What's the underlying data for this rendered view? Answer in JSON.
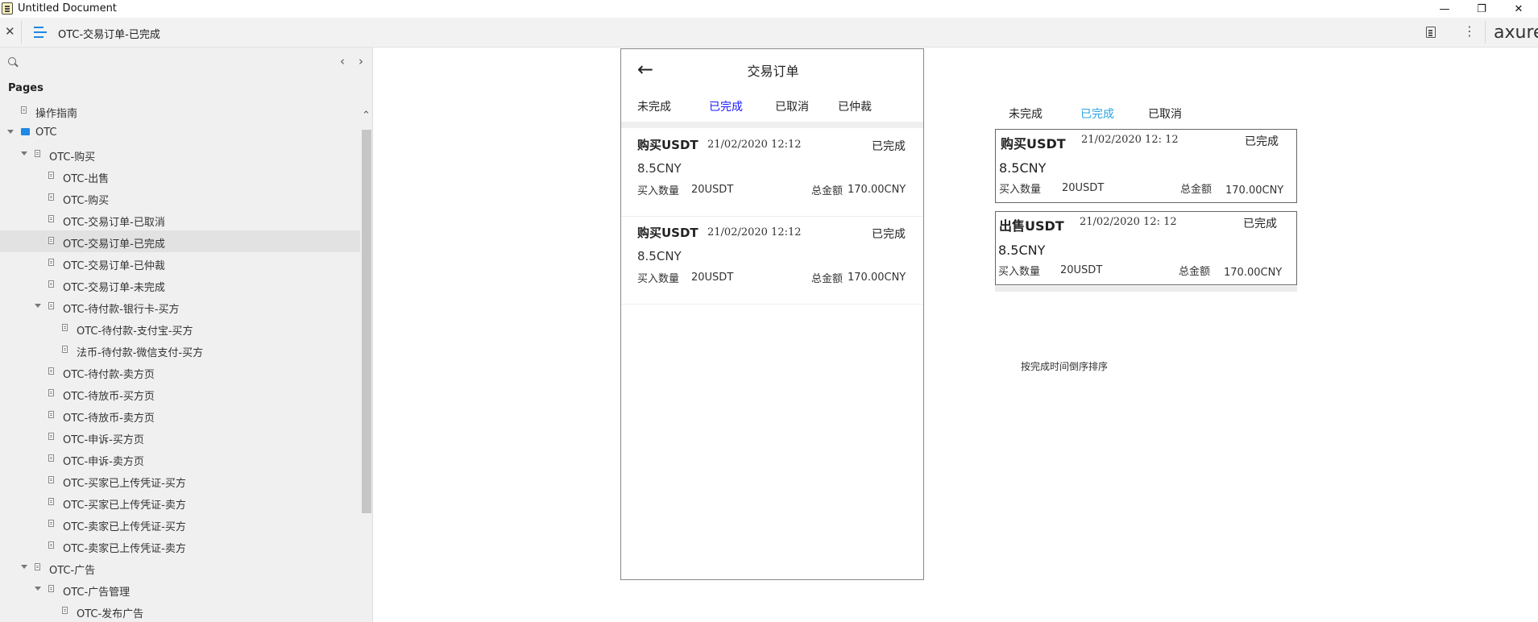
{
  "window": {
    "title": "Untitled Document",
    "minimize": "—",
    "restore": "❐",
    "close": "✕"
  },
  "toolbar": {
    "close_label": "✕",
    "page_name": "OTC-交易订单-已完成",
    "more": "⋮",
    "logo": "axure"
  },
  "sidebar": {
    "search_placeholder": "",
    "prev": "‹",
    "next": "›",
    "pages_label": "Pages",
    "scroll_up": "⌃",
    "items": [
      {
        "label": "操作指南",
        "level": 0,
        "type": "page",
        "caret": false,
        "selected": false
      },
      {
        "label": "OTC",
        "level": 0,
        "type": "folder",
        "caret": true,
        "selected": false
      },
      {
        "label": "OTC-购买",
        "level": 1,
        "type": "page",
        "caret": true,
        "selected": false
      },
      {
        "label": "OTC-出售",
        "level": 2,
        "type": "page",
        "caret": false,
        "selected": false
      },
      {
        "label": "OTC-购买",
        "level": 2,
        "type": "page",
        "caret": false,
        "selected": false
      },
      {
        "label": "OTC-交易订单-已取消",
        "level": 2,
        "type": "page",
        "caret": false,
        "selected": false
      },
      {
        "label": "OTC-交易订单-已完成",
        "level": 2,
        "type": "page",
        "caret": false,
        "selected": true
      },
      {
        "label": "OTC-交易订单-已仲裁",
        "level": 2,
        "type": "page",
        "caret": false,
        "selected": false
      },
      {
        "label": "OTC-交易订单-未完成",
        "level": 2,
        "type": "page",
        "caret": false,
        "selected": false
      },
      {
        "label": "OTC-待付款-银行卡-买方",
        "level": 2,
        "type": "page",
        "caret": true,
        "selected": false
      },
      {
        "label": "OTC-待付款-支付宝-买方",
        "level": 3,
        "type": "page",
        "caret": false,
        "selected": false
      },
      {
        "label": "法币-待付款-微信支付-买方",
        "level": 3,
        "type": "page",
        "caret": false,
        "selected": false
      },
      {
        "label": "OTC-待付款-卖方页",
        "level": 2,
        "type": "page",
        "caret": false,
        "selected": false
      },
      {
        "label": "OTC-待放币-买方页",
        "level": 2,
        "type": "page",
        "caret": false,
        "selected": false
      },
      {
        "label": "OTC-待放币-卖方页",
        "level": 2,
        "type": "page",
        "caret": false,
        "selected": false
      },
      {
        "label": "OTC-申诉-买方页",
        "level": 2,
        "type": "page",
        "caret": false,
        "selected": false
      },
      {
        "label": "OTC-申诉-卖方页",
        "level": 2,
        "type": "page",
        "caret": false,
        "selected": false
      },
      {
        "label": "OTC-买家已上传凭证-买方",
        "level": 2,
        "type": "page",
        "caret": false,
        "selected": false
      },
      {
        "label": "OTC-买家已上传凭证-卖方",
        "level": 2,
        "type": "page",
        "caret": false,
        "selected": false
      },
      {
        "label": "OTC-卖家已上传凭证-买方",
        "level": 2,
        "type": "page",
        "caret": false,
        "selected": false
      },
      {
        "label": "OTC-卖家已上传凭证-卖方",
        "level": 2,
        "type": "page",
        "caret": false,
        "selected": false
      },
      {
        "label": "OTC-广告",
        "level": 1,
        "type": "page",
        "caret": true,
        "selected": false
      },
      {
        "label": "OTC-广告管理",
        "level": 2,
        "type": "page",
        "caret": true,
        "selected": false
      },
      {
        "label": "OTC-发布广告",
        "level": 3,
        "type": "page",
        "caret": false,
        "selected": false
      }
    ]
  },
  "phone": {
    "back": "←",
    "title": "交易订单",
    "tabs": [
      {
        "label": "未完成",
        "active": false
      },
      {
        "label": "已完成",
        "active": true
      },
      {
        "label": "已取消",
        "active": false
      },
      {
        "label": "已仲裁",
        "active": false
      }
    ],
    "orders": [
      {
        "title": "购买USDT",
        "date": "21/02/2020 12:12",
        "status": "已完成",
        "price": "8.5CNY",
        "qty_label": "买入数量",
        "qty": "20USDT",
        "total_label": "总金额",
        "total": "170.00CNY"
      },
      {
        "title": "购买USDT",
        "date": "21/02/2020 12:12",
        "status": "已完成",
        "price": "8.5CNY",
        "qty_label": "买入数量",
        "qty": "20USDT",
        "total_label": "总金额",
        "total": "170.00CNY"
      }
    ]
  },
  "annotation": {
    "tabs": [
      {
        "label": "未完成",
        "active": false
      },
      {
        "label": "已完成",
        "active": true
      },
      {
        "label": "已取消",
        "active": false
      }
    ],
    "cards": [
      {
        "title": "购买USDT",
        "date": "21/02/2020 12: 12",
        "status": "已完成",
        "price": "8.5CNY",
        "qty_label": "买入数量",
        "qty": "20USDT",
        "total_label": "总金额",
        "total": "170.00CNY"
      },
      {
        "title": "出售USDT",
        "date": "21/02/2020 12: 12",
        "status": "已完成",
        "price": "8.5CNY",
        "qty_label": "买入数量",
        "qty": "20USDT",
        "total_label": "总金额",
        "total": "170.00CNY"
      }
    ],
    "note": "按完成时间倒序排序"
  },
  "colors": {
    "active_tab_phone": "#1a1aff",
    "active_tab_annotation": "#29a3e0",
    "folder_icon": "#1e88e5",
    "selected_row": "#e2e2e2"
  }
}
